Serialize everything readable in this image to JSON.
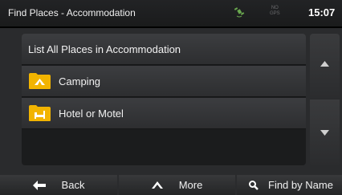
{
  "title": "Find Places - Accommodation",
  "status": {
    "gps_text": "NO GPS",
    "time": "15:07"
  },
  "list": {
    "header": "List All Places in Accommodation",
    "items": [
      {
        "label": "Camping",
        "icon": "tent-icon"
      },
      {
        "label": "Hotel or Motel",
        "icon": "bed-icon"
      }
    ]
  },
  "colors": {
    "folder": "#f2b400",
    "panel": "#1b1c1d",
    "row": "#353638"
  },
  "bottom": {
    "back": "Back",
    "more": "More",
    "find": "Find by Name"
  }
}
